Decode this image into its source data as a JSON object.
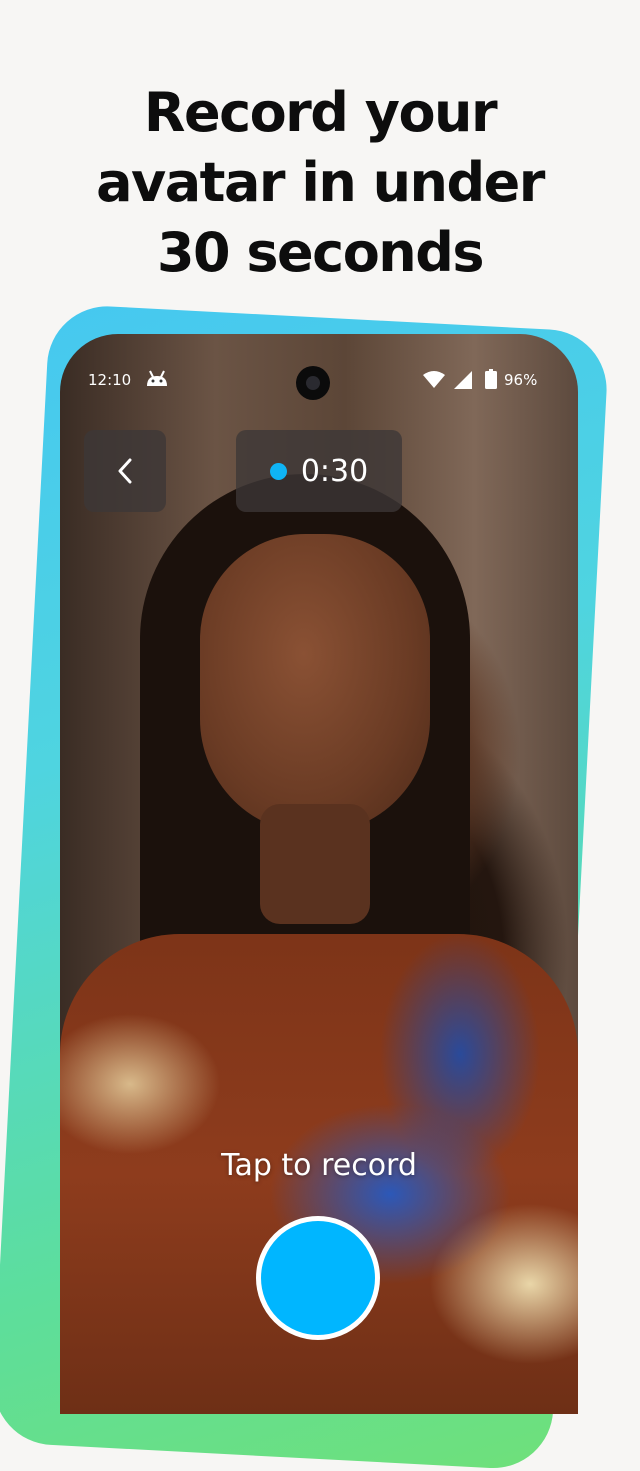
{
  "headline": {
    "line1": "Record your",
    "line2": "avatar in under",
    "line3": "30 seconds"
  },
  "status_bar": {
    "time": "12:10",
    "battery": "96%",
    "icons": [
      "android-icon",
      "wifi-icon",
      "signal-icon",
      "battery-icon"
    ]
  },
  "recorder": {
    "back_icon": "chevron-left-icon",
    "timer": "0:30",
    "tap_label": "Tap to record",
    "accent_color": "#00b6ff"
  }
}
